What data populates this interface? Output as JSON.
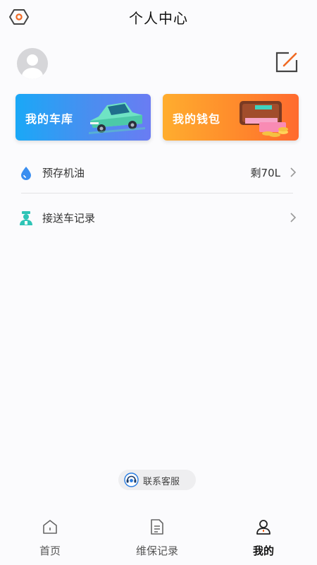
{
  "header": {
    "title": "个人中心",
    "settings_icon": "settings-hex-icon",
    "edit_icon": "edit-icon"
  },
  "profile": {
    "avatar_icon": "avatar-placeholder-icon"
  },
  "cards": [
    {
      "label": "我的车库",
      "icon": "car-illustration",
      "gradient": [
        "#1aa8f7",
        "#6a7cf3"
      ]
    },
    {
      "label": "我的钱包",
      "icon": "wallet-illustration",
      "gradient": [
        "#ffad2e",
        "#ff6a2e"
      ]
    }
  ],
  "list": [
    {
      "label": "预存机油",
      "value": "剩70L",
      "icon": "oil-drop-icon"
    },
    {
      "label": "接送车记录",
      "value": "",
      "icon": "driver-icon"
    }
  ],
  "service": {
    "label": "联系客服",
    "icon": "headset-icon"
  },
  "tabs": [
    {
      "label": "首页",
      "icon": "home-icon",
      "active": false
    },
    {
      "label": "维保记录",
      "icon": "document-icon",
      "active": false
    },
    {
      "label": "我的",
      "icon": "user-icon",
      "active": true
    }
  ],
  "colors": {
    "accent_orange": "#f06a24",
    "accent_blue": "#3a8ef0",
    "background": "#fbfbfd"
  }
}
